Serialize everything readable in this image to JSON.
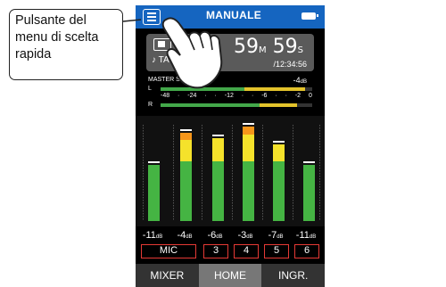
{
  "callout": {
    "text": "Pulsante del menu di scelta rapida"
  },
  "screen": {
    "title": "MANUALE",
    "rec": {
      "mode": "♪ TASCAM",
      "minutes": "59",
      "min_unit": "M",
      "seconds": "59",
      "sec_unit": "S",
      "remaining": "/12:34:56"
    },
    "meter_header": {
      "left": "MASTER STEREO",
      "peak": "-4",
      "peak_unit": "dB"
    },
    "stereo_meter": {
      "channels": [
        "L",
        "R"
      ],
      "scale": [
        "-48",
        "·",
        "-24",
        "·",
        "·",
        "-12",
        "·",
        "·",
        "-6",
        "·",
        "·",
        "-2",
        "0"
      ],
      "levels": {
        "L_green": 0.55,
        "L_yellow_end": 0.95,
        "R_green": 0.65,
        "R_yellow_end": 0.9
      }
    },
    "channels": [
      {
        "level": "-11",
        "unit": "dB",
        "chip": "MIC",
        "fill": 0.58,
        "yellow": 0.0,
        "orange": 0.0
      },
      {
        "level": "-4",
        "unit": "dB",
        "chip": "",
        "fill": 0.62,
        "yellow": 0.22,
        "orange": 0.08
      },
      {
        "level": "-6",
        "unit": "dB",
        "chip": "3",
        "fill": 0.62,
        "yellow": 0.24,
        "orange": 0.0
      },
      {
        "level": "-3",
        "unit": "dB",
        "chip": "4",
        "fill": 0.62,
        "yellow": 0.28,
        "orange": 0.08
      },
      {
        "level": "-7",
        "unit": "dB",
        "chip": "5",
        "fill": 0.62,
        "yellow": 0.18,
        "orange": 0.0
      },
      {
        "level": "-11",
        "unit": "dB",
        "chip": "6",
        "fill": 0.58,
        "yellow": 0.0,
        "orange": 0.0
      }
    ],
    "tabs": [
      "MIXER",
      "HOME",
      "INGR."
    ],
    "active_tab": "HOME",
    "colors": {
      "topbar": "#1565c0",
      "green": "#45b443",
      "yellow": "#f5e22b",
      "orange": "#f6961a",
      "chip_border": "#e53935"
    }
  }
}
